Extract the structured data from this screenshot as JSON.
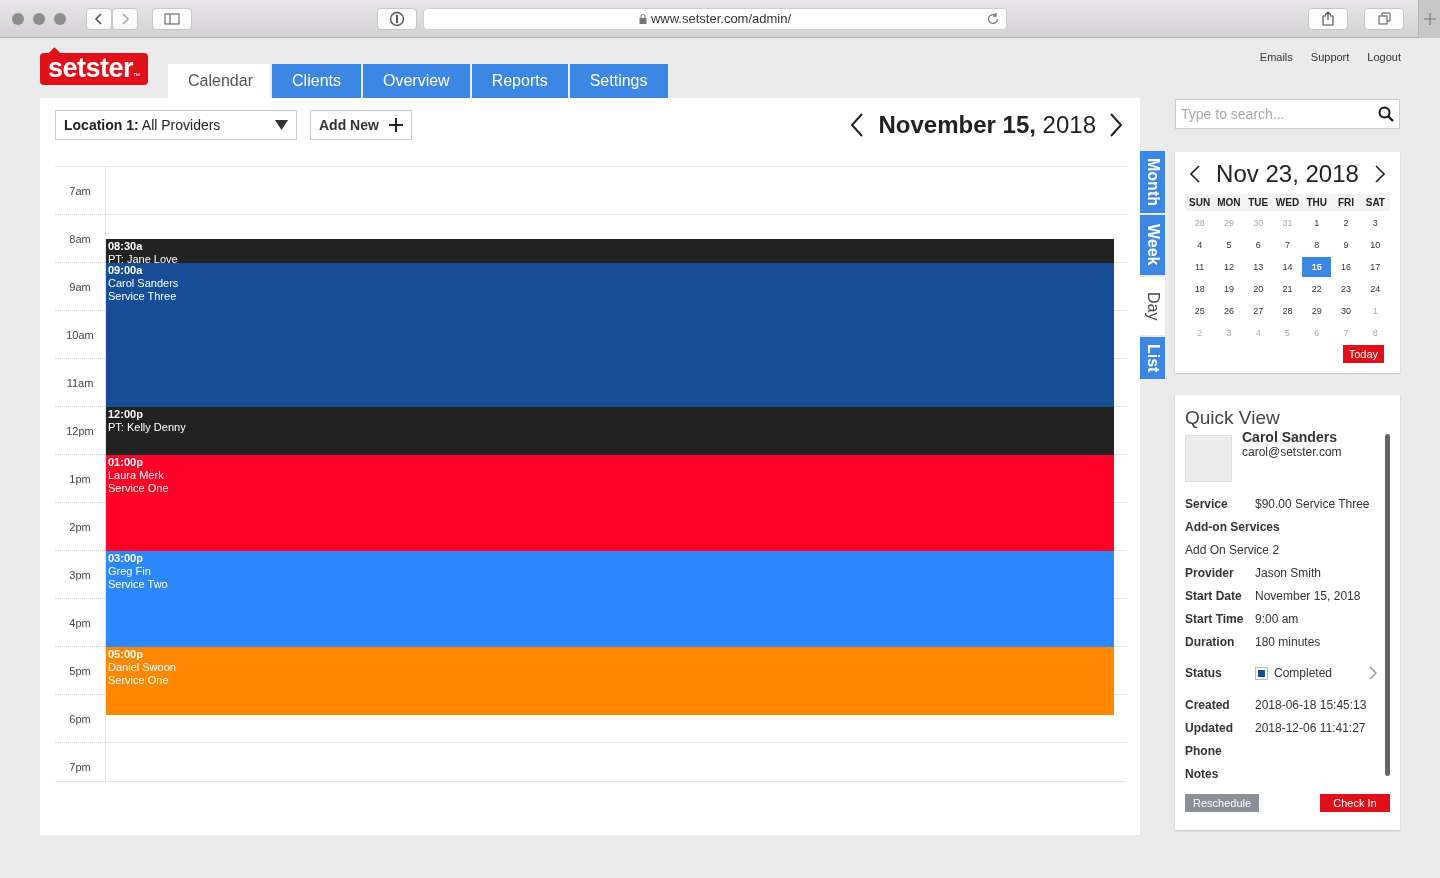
{
  "browser": {
    "url": "www.setster.com/admin/"
  },
  "logo": {
    "text": "setster",
    "mark": "™"
  },
  "top_links": [
    "Emails",
    "Support",
    "Logout"
  ],
  "tabs": [
    {
      "label": "Calendar",
      "selected": true
    },
    {
      "label": "Clients",
      "selected": false
    },
    {
      "label": "Overview",
      "selected": false
    },
    {
      "label": "Reports",
      "selected": false
    },
    {
      "label": "Settings",
      "selected": false
    }
  ],
  "location_select": {
    "value": "**Location 1:** All Providers"
  },
  "add_button": {
    "label": "Add New"
  },
  "date_heading": "**November 15,** 2018",
  "hours": [
    "7am",
    "8am",
    "9am",
    "10am",
    "11am",
    "12pm",
    "1pm",
    "2pm",
    "3pm",
    "4pm",
    "5pm",
    "6pm",
    "7pm"
  ],
  "events": [
    {
      "time": "08:30a",
      "lines": [
        "PT: Jane Love"
      ],
      "color": "#222222"
    },
    {
      "time": "09:00a",
      "lines": [
        "Carol Sanders",
        "Service Three"
      ],
      "color": "#164e96"
    },
    {
      "time": "12:00p",
      "lines": [
        "PT: Kelly Denny"
      ],
      "color": "#222222"
    },
    {
      "time": "01:00p",
      "lines": [
        "Laura Merk",
        "Service One"
      ],
      "color": "#ff0026"
    },
    {
      "time": "03:00p",
      "lines": [
        "Greg Fin",
        "Service Two"
      ],
      "color": "#2d87ff"
    },
    {
      "time": "05:00p",
      "lines": [
        "Daniel Swoon",
        "Service One"
      ],
      "color": "#ff8800"
    }
  ],
  "view_tabs": [
    {
      "label": "Month",
      "selected": false
    },
    {
      "label": "Week",
      "selected": false
    },
    {
      "label": "Day",
      "selected": true
    },
    {
      "label": "List",
      "selected": false
    }
  ],
  "search": {
    "placeholder": "Type to search..."
  },
  "mini_calendar": {
    "title": "Nov 23, 2018",
    "weekdays": [
      "SUN",
      "MON",
      "TUE",
      "WED",
      "THU",
      "FRI",
      "SAT"
    ],
    "weeks": [
      [
        {
          "day": "28",
          "muted": true,
          "selected": false
        },
        {
          "day": "29",
          "muted": true,
          "selected": false
        },
        {
          "day": "30",
          "muted": true,
          "selected": false
        },
        {
          "day": "31",
          "muted": true,
          "selected": false
        },
        {
          "day": "1",
          "muted": false,
          "selected": false
        },
        {
          "day": "2",
          "muted": false,
          "selected": false
        },
        {
          "day": "3",
          "muted": false,
          "selected": false
        }
      ],
      [
        {
          "day": "4",
          "muted": false,
          "selected": false
        },
        {
          "day": "5",
          "muted": false,
          "selected": false
        },
        {
          "day": "6",
          "muted": false,
          "selected": false
        },
        {
          "day": "7",
          "muted": false,
          "selected": false
        },
        {
          "day": "8",
          "muted": false,
          "selected": false
        },
        {
          "day": "9",
          "muted": false,
          "selected": false
        },
        {
          "day": "10",
          "muted": false,
          "selected": false
        }
      ],
      [
        {
          "day": "11",
          "muted": false,
          "selected": false
        },
        {
          "day": "12",
          "muted": false,
          "selected": false
        },
        {
          "day": "13",
          "muted": false,
          "selected": false
        },
        {
          "day": "14",
          "muted": false,
          "selected": false
        },
        {
          "day": "15",
          "muted": false,
          "selected": true
        },
        {
          "day": "16",
          "muted": false,
          "selected": false
        },
        {
          "day": "17",
          "muted": false,
          "selected": false
        }
      ],
      [
        {
          "day": "18",
          "muted": false,
          "selected": false
        },
        {
          "day": "19",
          "muted": false,
          "selected": false
        },
        {
          "day": "20",
          "muted": false,
          "selected": false
        },
        {
          "day": "21",
          "muted": false,
          "selected": false
        },
        {
          "day": "22",
          "muted": false,
          "selected": false
        },
        {
          "day": "23",
          "muted": false,
          "selected": false
        },
        {
          "day": "24",
          "muted": false,
          "selected": false
        }
      ],
      [
        {
          "day": "25",
          "muted": false,
          "selected": false
        },
        {
          "day": "26",
          "muted": false,
          "selected": false
        },
        {
          "day": "27",
          "muted": false,
          "selected": false
        },
        {
          "day": "28",
          "muted": false,
          "selected": false
        },
        {
          "day": "29",
          "muted": false,
          "selected": false
        },
        {
          "day": "30",
          "muted": false,
          "selected": false
        },
        {
          "day": "1",
          "muted": true,
          "selected": false
        }
      ],
      [
        {
          "day": "2",
          "muted": true,
          "selected": false
        },
        {
          "day": "3",
          "muted": true,
          "selected": false
        },
        {
          "day": "4",
          "muted": true,
          "selected": false
        },
        {
          "day": "5",
          "muted": true,
          "selected": false
        },
        {
          "day": "6",
          "muted": true,
          "selected": false
        },
        {
          "day": "7",
          "muted": true,
          "selected": false
        },
        {
          "day": "8",
          "muted": true,
          "selected": false
        }
      ]
    ],
    "today_button": "Today"
  },
  "quick_view": {
    "title": "Quick View",
    "name": "Carol Sanders",
    "email": "carol@setster.com",
    "fields": [
      {
        "kind": "pair",
        "label": "Service",
        "value": "$90.00 Service Three"
      },
      {
        "kind": "heading",
        "label": "Add-on Services"
      },
      {
        "kind": "text",
        "value": "Add On Service 2"
      },
      {
        "kind": "pair",
        "label": "Provider",
        "value": "Jason Smith"
      },
      {
        "kind": "pair",
        "label": "Start Date",
        "value": "November 15, 2018"
      },
      {
        "kind": "pair",
        "label": "Start Time",
        "value": "9:00 am"
      },
      {
        "kind": "pair",
        "label": "Duration",
        "value": "180 minutes"
      },
      {
        "kind": "status",
        "label": "Status",
        "value": "Completed",
        "color": "#164e96"
      },
      {
        "kind": "pair",
        "label": "Created",
        "value": "2018-06-18 15:45:13"
      },
      {
        "kind": "pair",
        "label": "Updated",
        "value": "2018-12-06 11:41:27"
      },
      {
        "kind": "heading",
        "label": "Phone"
      },
      {
        "kind": "heading",
        "label": "Notes"
      }
    ],
    "buttons": [
      {
        "kind": "secondary",
        "label": "Reschedule"
      },
      {
        "kind": "primary",
        "label": "Check In"
      }
    ]
  }
}
